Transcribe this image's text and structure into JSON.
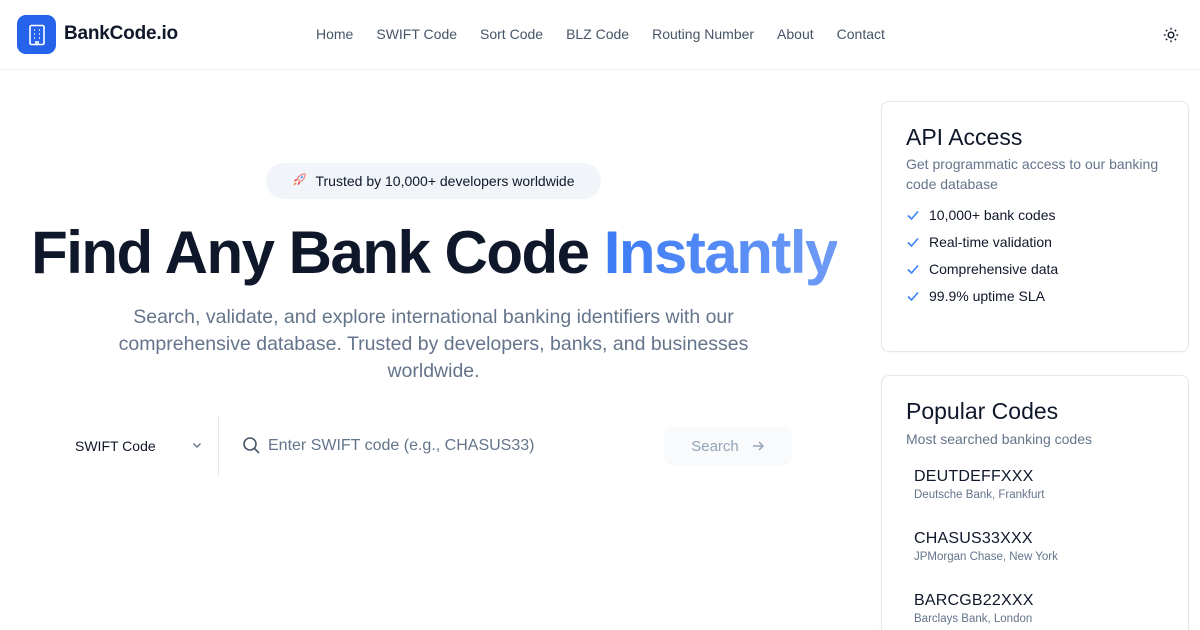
{
  "brand": {
    "name": "BankCode.io",
    "logo_icon": "building-icon",
    "accent": "#2563eb"
  },
  "nav": [
    {
      "label": "Home"
    },
    {
      "label": "SWIFT Code"
    },
    {
      "label": "Sort Code"
    },
    {
      "label": "BLZ Code"
    },
    {
      "label": "Routing Number"
    },
    {
      "label": "About"
    },
    {
      "label": "Contact"
    }
  ],
  "theme_toggle": {
    "icon": "sun-icon"
  },
  "hero": {
    "badge_icon": "rocket-icon",
    "badge": "Trusted by 10,000+ developers worldwide",
    "title_main": "Find Any Bank Code",
    "title_accent": "Instantly",
    "subtitle": "Search, validate, and explore international banking identifiers with our comprehensive database. Trusted by developers, banks, and businesses worldwide."
  },
  "search": {
    "type_selected": "SWIFT Code",
    "placeholder": "Enter SWIFT code (e.g., CHASUS33)",
    "value": "",
    "button_label": "Search"
  },
  "api_card": {
    "title": "API Access",
    "description": "Get programmatic access to our banking code database",
    "features": [
      "10,000+ bank codes",
      "Real-time validation",
      "Comprehensive data",
      "99.9% uptime SLA"
    ]
  },
  "popular_card": {
    "title": "Popular Codes",
    "description": "Most searched banking codes",
    "items": [
      {
        "code": "DEUTDEFFXXX",
        "bank": "Deutsche Bank, Frankfurt"
      },
      {
        "code": "CHASUS33XXX",
        "bank": "JPMorgan Chase, New York"
      },
      {
        "code": "BARCGB22XXX",
        "bank": "Barclays Bank, London"
      }
    ]
  }
}
